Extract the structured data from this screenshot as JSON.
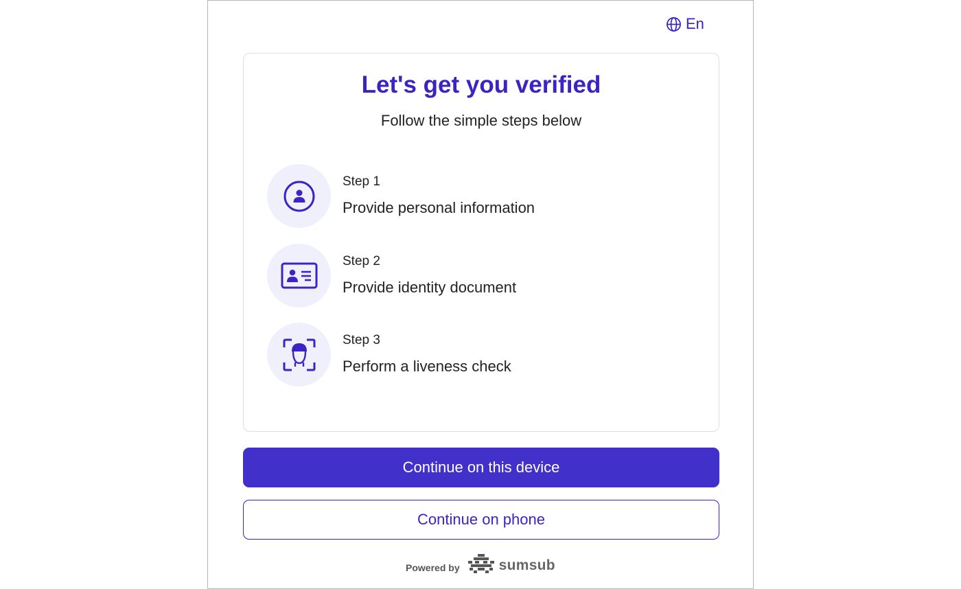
{
  "language": {
    "label": "En",
    "icon": "globe-icon"
  },
  "card": {
    "title": "Let's get you verified",
    "subtitle": "Follow the simple steps below",
    "steps": [
      {
        "label": "Step 1",
        "description": "Provide personal information",
        "icon": "user-circle-icon"
      },
      {
        "label": "Step 2",
        "description": "Provide identity document",
        "icon": "id-card-icon"
      },
      {
        "label": "Step 3",
        "description": "Perform a liveness check",
        "icon": "face-scan-icon"
      }
    ]
  },
  "actions": {
    "primary_label": "Continue on this device",
    "secondary_label": "Continue on phone"
  },
  "footer": {
    "powered_by": "Powered by",
    "brand": "sumsub",
    "brand_icon": "sumsub-logo-icon"
  },
  "colors": {
    "accent": "#3b23c4",
    "button": "#4130c9",
    "icon_bg": "#eff0fb"
  }
}
